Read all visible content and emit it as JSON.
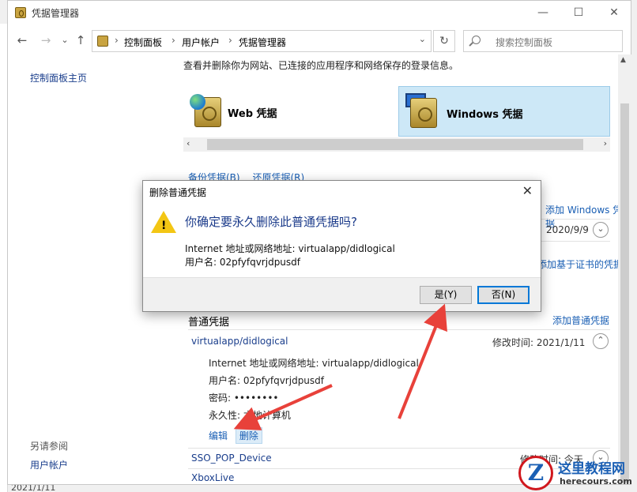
{
  "window": {
    "title": "凭据管理器",
    "min_glyph": "—",
    "max_glyph": "☐",
    "close_glyph": "✕"
  },
  "nav": {
    "back_glyph": "←",
    "forward_glyph": "→",
    "history_glyph": "⌄",
    "up_glyph": "↑",
    "breadcrumb": [
      "控制面板",
      "用户帐户",
      "凭据管理器"
    ],
    "sep_glyph": "›",
    "refresh_glyph": "↻",
    "search_placeholder": "搜索控制面板"
  },
  "sidebar": {
    "home": "控制面板主页",
    "see_also": "另请参阅",
    "user_accounts": "用户帐户"
  },
  "main": {
    "intro": "查看并删除你为网站、已连接的应用程序和网络保存的登录信息。",
    "tabs": [
      {
        "label": "Web 凭据",
        "icon": "web-vault-icon",
        "selected": false
      },
      {
        "label": "Windows 凭据",
        "icon": "windows-vault-icon",
        "selected": true
      }
    ],
    "backup": "备份凭据(B)",
    "restore": "还原凭据(R)",
    "add_windows": "添加 Windows 凭据",
    "date_1": "2020/9/9",
    "add_cert": "添加基于证书的凭据",
    "generic_section": "普通凭据",
    "add_generic": "添加普通凭据",
    "expanded": {
      "name": "virtualapp/didlogical",
      "modified": "修改时间:  2021/1/11",
      "address": "Internet 地址或网络地址:  virtualapp/didlogical",
      "username": "用户名:  02pfyfqvrjdpusdf",
      "password": "密码:  ••••••••",
      "persistence": "永久性:  本地计算机",
      "edit": "编辑",
      "delete": "删除"
    },
    "items": [
      {
        "name": "SSO_POP_Device",
        "modified": "修改时间:  今天"
      },
      {
        "name": "XboxLive"
      }
    ]
  },
  "dialog": {
    "title": "删除普通凭据",
    "question": "你确定要永久删除此普通凭据吗?",
    "address": "Internet 地址或网络地址: virtualapp/didlogical",
    "username": "用户名: 02pfyfqvrjdpusdf",
    "yes": "是(Y)",
    "no": "否(N)",
    "close_glyph": "✕"
  },
  "background": {
    "bottom_date": "2021/1/11"
  },
  "watermark": {
    "logo_letter": "Z",
    "name": "这里教程网",
    "domain": "herecours.com"
  },
  "colors": {
    "link": "#1a5fb4",
    "accent": "#0078d7",
    "arrow": "#e8413a",
    "selected_tile": "#cde8f7"
  }
}
